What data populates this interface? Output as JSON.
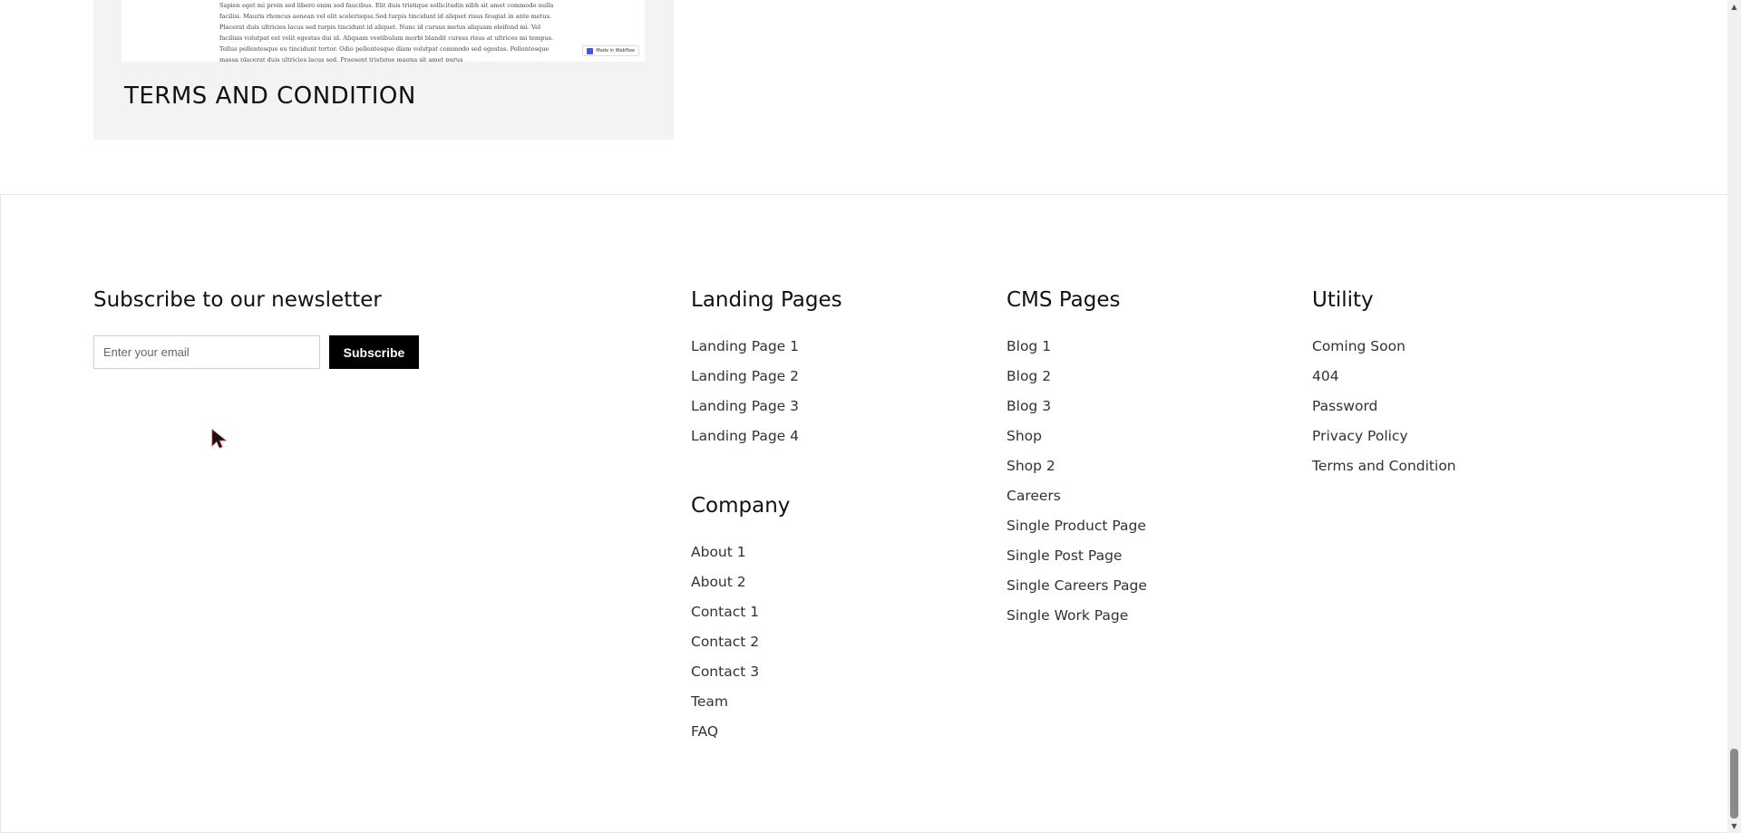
{
  "card": {
    "thumb_text": "Sapien eget mi proin sed libero enim sed faucibus. Elit duis tristique sollicitudin nibh sit amet commodo nulla facilisi. Mauris rhoncus aenean vel elit scelerisque.Sed turpis tincidunt id aliquet risus feugiat in ante metus. Placerat duis ultricies lacus sed turpis tincidunt id aliquet. Nunc id cursus metus aliquam eleifend mi. Vel facilisis volutpat est velit egestas dui id. Aliquam vestibulum morbi blandit cursus risus at ultrices mi tempus. Tellus pellentesque eu tincidunt tortor. Odio pellentesque diam volutpat commodo sed egestas. Pellentesque massa placerat duis ultricies lacus sed. Praesent tristique magna sit amet purus",
    "badge": "Made in Webflow",
    "title": "TERMS AND CONDITION"
  },
  "newsletter": {
    "title": "Subscribe to our newsletter",
    "placeholder": "Enter your email",
    "button": "Subscribe"
  },
  "columns": {
    "landing": {
      "title": "Landing Pages",
      "links": [
        "Landing Page 1",
        "Landing Page 2",
        "Landing Page 3",
        "Landing Page 4"
      ]
    },
    "company": {
      "title": "Company",
      "links": [
        "About 1",
        "About 2",
        "Contact 1",
        "Contact 2",
        "Contact 3",
        "Team",
        "FAQ"
      ]
    },
    "cms": {
      "title": "CMS Pages",
      "links": [
        "Blog 1",
        "Blog 2",
        "Blog 3",
        "Shop",
        "Shop 2",
        "Careers",
        "Single Product Page",
        "Single Post Page",
        "Single Careers Page",
        "Single Work Page"
      ]
    },
    "utility": {
      "title": "Utility",
      "links": [
        "Coming Soon",
        "404",
        "Password",
        "Privacy Policy",
        "Terms and Condition"
      ]
    }
  },
  "icons": {
    "cursor": "mouse-pointer-icon",
    "scroll_up": "scroll-up-arrow-icon",
    "scroll_down": "scroll-down-arrow-icon"
  }
}
